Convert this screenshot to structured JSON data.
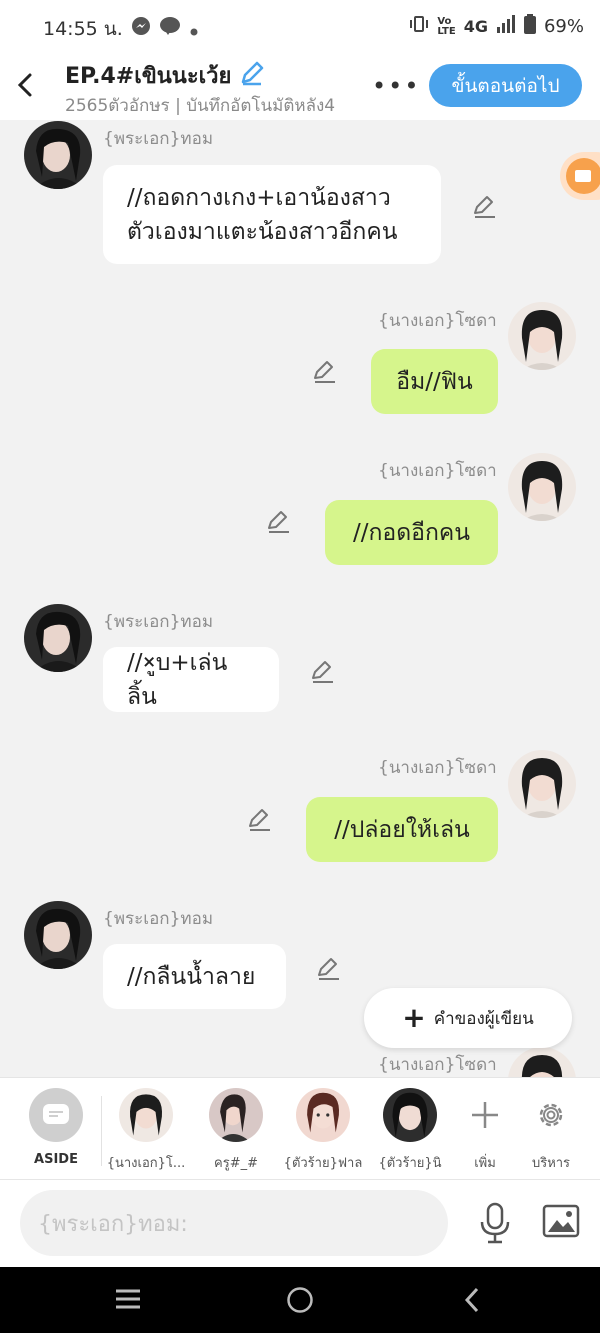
{
  "status_bar": {
    "time": "14:55 น.",
    "network": "4G",
    "battery": "69%"
  },
  "header": {
    "title": "EP.4#เขินนะเว้ย",
    "subtitle": "2565ตัวอักษร | บันทึกอัตโนมัติหลัง4",
    "next_button": "ขั้นตอนต่อไป"
  },
  "messages": [
    {
      "side": "left",
      "speaker": "{พระเอก}ทอม",
      "lines": [
        "//ถอดกางเกง+เอาน้องสาว",
        "ตัวเองมาแตะน้องสาวอีกคน"
      ]
    },
    {
      "side": "right",
      "speaker": "{นางเอก}โซดา",
      "lines": [
        "อืม//ฟิน"
      ]
    },
    {
      "side": "right",
      "speaker": "{นางเอก}โซดา",
      "lines": [
        "//กอดอีกคน"
      ]
    },
    {
      "side": "left",
      "speaker": "{พระเอก}ทอม",
      "lines": [
        "//×ูบ+เล่นลิ้น"
      ]
    },
    {
      "side": "right",
      "speaker": "{นางเอก}โซดา",
      "lines": [
        "//ปล่อยให้เล่น"
      ]
    },
    {
      "side": "left",
      "speaker": "{พระเอก}ทอม",
      "lines": [
        "//กลืนน้ำลาย"
      ]
    },
    {
      "side": "right",
      "speaker": "{นางเอก}โซดา",
      "lines": []
    }
  ],
  "author_note_button": "คำของผู้เขียน",
  "cast_bar": {
    "aside_label": "ASIDE",
    "characters": [
      "{นางเอก}โ...",
      "ครู#_#",
      "{ตัวร้าย}ฟาล",
      "{ตัวร้าย}นิ"
    ],
    "add_label": "เพิ่ม",
    "manage_label": "บริหาร"
  },
  "input": {
    "placeholder": "{พระเอก}ทอม:"
  },
  "colors": {
    "accent": "#4aa3ec",
    "right_bubble": "#d6f58c",
    "left_bubble": "#ffffff",
    "background": "#f2f2f2"
  }
}
